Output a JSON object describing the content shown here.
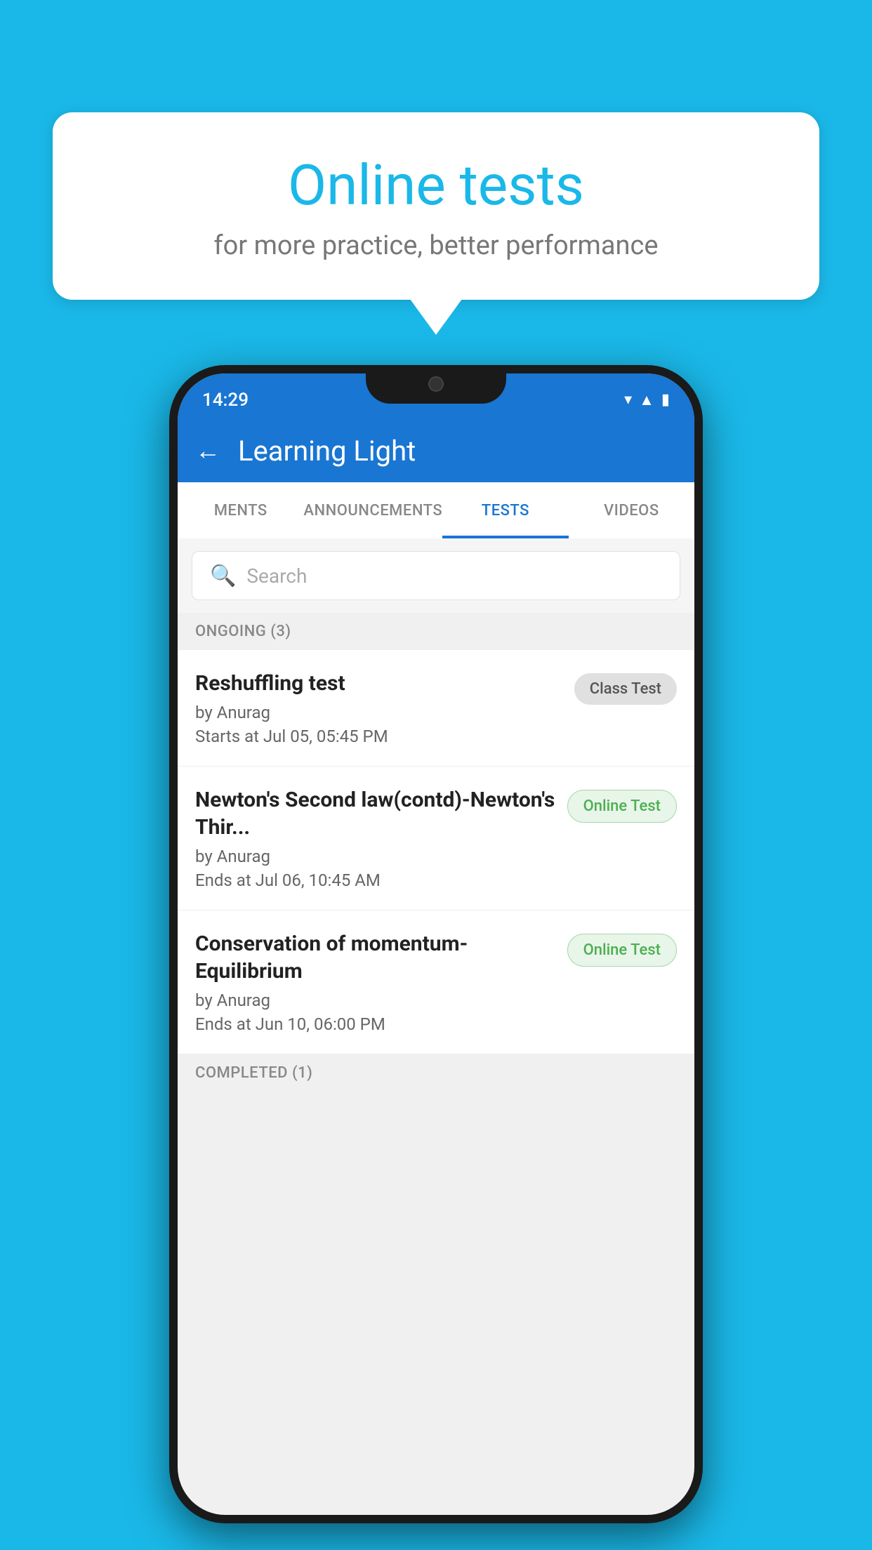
{
  "background_color": "#1ab8e8",
  "bubble": {
    "title": "Online tests",
    "subtitle": "for more practice, better performance"
  },
  "phone": {
    "status_bar": {
      "time": "14:29",
      "icons": [
        "wifi",
        "signal",
        "battery"
      ]
    },
    "app_bar": {
      "title": "Learning Light",
      "back_label": "←"
    },
    "tabs": [
      {
        "label": "MENTS",
        "active": false
      },
      {
        "label": "ANNOUNCEMENTS",
        "active": false
      },
      {
        "label": "TESTS",
        "active": true
      },
      {
        "label": "VIDEOS",
        "active": false
      }
    ],
    "search": {
      "placeholder": "Search"
    },
    "ongoing_section": {
      "title": "ONGOING (3)"
    },
    "tests": [
      {
        "name": "Reshuffling test",
        "author": "by Anurag",
        "date": "Starts at  Jul 05, 05:45 PM",
        "badge": "Class Test",
        "badge_type": "class"
      },
      {
        "name": "Newton's Second law(contd)-Newton's Thir...",
        "author": "by Anurag",
        "date": "Ends at  Jul 06, 10:45 AM",
        "badge": "Online Test",
        "badge_type": "online"
      },
      {
        "name": "Conservation of momentum-Equilibrium",
        "author": "by Anurag",
        "date": "Ends at  Jun 10, 06:00 PM",
        "badge": "Online Test",
        "badge_type": "online"
      }
    ],
    "completed_section": {
      "title": "COMPLETED (1)"
    }
  }
}
